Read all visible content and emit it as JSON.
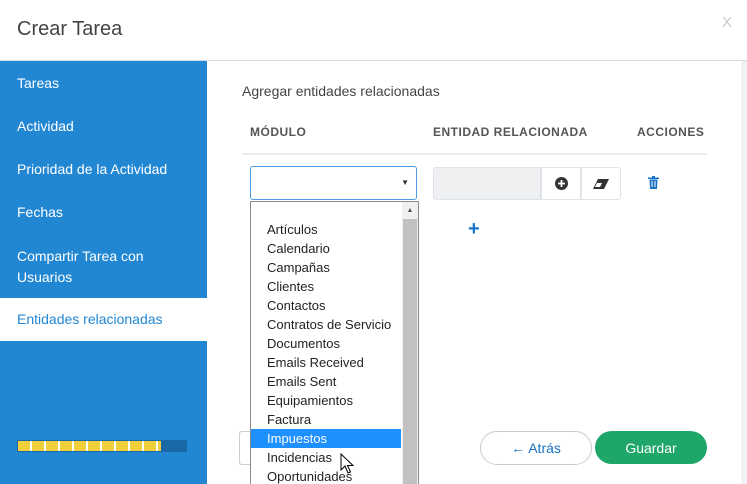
{
  "header": {
    "title": "Crear Tarea",
    "close_label": "X"
  },
  "sidebar": {
    "items": [
      {
        "label": "Tareas"
      },
      {
        "label": "Actividad"
      },
      {
        "label": "Prioridad de la Actividad"
      },
      {
        "label": "Fechas"
      },
      {
        "label": "Compartir Tarea con Usuarios"
      },
      {
        "label": "Entidades relacionadas"
      }
    ],
    "active_index": 5,
    "progress": 0.85
  },
  "main": {
    "section_title": "Agregar entidades relacionadas",
    "columns": [
      "MÓDULO",
      "ENTIDAD RELACIONADA",
      "ACCIONES"
    ],
    "module_select": {
      "value": ""
    },
    "add_icon": "+",
    "back_label": "← Atrás",
    "save_label": "Guardar"
  },
  "dropdown": {
    "options": [
      "",
      "Artículos",
      "Calendario",
      "Campañas",
      "Clientes",
      "Contactos",
      "Contratos de Servicio",
      "Documentos",
      "Emails Received",
      "Emails Sent",
      "Equipamientos",
      "Factura",
      "Impuestos",
      "Incidencias",
      "Oportunidades"
    ],
    "highlighted_index": 12
  },
  "icons": {
    "close": "close-icon",
    "caret": "caret-down-icon",
    "add_related": "plus-circle-icon",
    "clear": "eraser-icon",
    "delete": "trash-icon",
    "add_row": "plus-icon",
    "cursor": "mouse-pointer-icon"
  },
  "colors": {
    "sidebar": "#2287d3",
    "primary_text": "#1a73c7",
    "save": "#1fa76a",
    "highlight": "#1e90ff",
    "progress_stripe": "#f1d03b"
  }
}
